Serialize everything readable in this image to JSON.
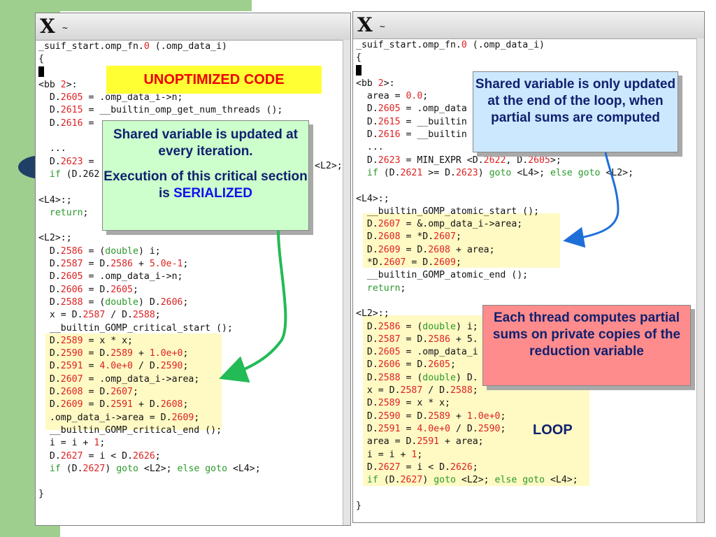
{
  "left_window": {
    "title_icon": "x-window-icon",
    "title": "~",
    "lines": [
      [
        [
          "_suif_start.omp_fn.",
          ""
        ],
        [
          "0",
          "num"
        ],
        [
          " (.omp_data_i)",
          ""
        ]
      ],
      [
        [
          "{",
          ""
        ]
      ],
      [
        [
          "__CURSOR__",
          ""
        ]
      ],
      [
        [
          "<bb ",
          ""
        ],
        [
          "2",
          "num"
        ],
        [
          ">:",
          ""
        ]
      ],
      [
        [
          "  D.",
          ""
        ],
        [
          "2605",
          "num"
        ],
        [
          " = .omp_data_i->n;",
          ""
        ]
      ],
      [
        [
          "  D.",
          ""
        ],
        [
          "2615",
          "num"
        ],
        [
          " = __builtin_omp_get_num_threads ();",
          ""
        ]
      ],
      [
        [
          "  D.",
          ""
        ],
        [
          "2616",
          "num"
        ],
        [
          " = ",
          ""
        ]
      ],
      [
        [
          "",
          ""
        ]
      ],
      [
        [
          "  ...",
          ""
        ]
      ],
      [
        [
          "  D.",
          ""
        ],
        [
          "2623",
          "num"
        ],
        [
          " = ",
          ""
        ]
      ],
      [
        [
          "  ",
          ""
        ],
        [
          "if",
          "kw"
        ],
        [
          " (D.",
          ""
        ],
        [
          "262",
          ""
        ]
      ],
      [
        [
          "",
          ""
        ]
      ],
      [
        [
          "<L4>:;",
          ""
        ]
      ],
      [
        [
          "  ",
          ""
        ],
        [
          "return",
          "kw"
        ],
        [
          ";",
          ""
        ]
      ],
      [
        [
          "",
          ""
        ]
      ],
      [
        [
          "<L2>:;",
          ""
        ]
      ],
      [
        [
          "  D.",
          ""
        ],
        [
          "2586",
          "num"
        ],
        [
          " = (",
          ""
        ],
        [
          "double",
          "ty"
        ],
        [
          ") i;",
          ""
        ]
      ],
      [
        [
          "  D.",
          ""
        ],
        [
          "2587",
          "num"
        ],
        [
          " = D.",
          ""
        ],
        [
          "2586",
          "num"
        ],
        [
          " + ",
          ""
        ],
        [
          "5.0e-1",
          "num"
        ],
        [
          ";",
          ""
        ]
      ],
      [
        [
          "  D.",
          ""
        ],
        [
          "2605",
          "num"
        ],
        [
          " = .omp_data_i->n;",
          ""
        ]
      ],
      [
        [
          "  D.",
          ""
        ],
        [
          "2606",
          "num"
        ],
        [
          " = D.",
          ""
        ],
        [
          "2605",
          "num"
        ],
        [
          ";",
          ""
        ]
      ],
      [
        [
          "  D.",
          ""
        ],
        [
          "2588",
          "num"
        ],
        [
          " = (",
          ""
        ],
        [
          "double",
          "ty"
        ],
        [
          ") D.",
          ""
        ],
        [
          "2606",
          "num"
        ],
        [
          ";",
          ""
        ]
      ],
      [
        [
          "  x = D.",
          ""
        ],
        [
          "2587",
          "num"
        ],
        [
          " / D.",
          ""
        ],
        [
          "2588",
          "num"
        ],
        [
          ";",
          ""
        ]
      ],
      [
        [
          "  __builtin_GOMP_critical_start ();",
          ""
        ]
      ],
      [
        [
          "  D.",
          ""
        ],
        [
          "2589",
          "num"
        ],
        [
          " = x * x;",
          ""
        ]
      ],
      [
        [
          "  D.",
          ""
        ],
        [
          "2590",
          "num"
        ],
        [
          " = D.",
          ""
        ],
        [
          "2589",
          "num"
        ],
        [
          " + ",
          ""
        ],
        [
          "1.0e+0",
          "num"
        ],
        [
          ";",
          ""
        ]
      ],
      [
        [
          "  D.",
          ""
        ],
        [
          "2591",
          "num"
        ],
        [
          " = ",
          ""
        ],
        [
          "4.0e+0",
          "num"
        ],
        [
          " / D.",
          ""
        ],
        [
          "2590",
          "num"
        ],
        [
          ";",
          ""
        ]
      ],
      [
        [
          "  D.",
          ""
        ],
        [
          "2607",
          "num"
        ],
        [
          " = .omp_data_i->area;",
          ""
        ]
      ],
      [
        [
          "  D.",
          ""
        ],
        [
          "2608",
          "num"
        ],
        [
          " = D.",
          ""
        ],
        [
          "2607",
          "num"
        ],
        [
          ";",
          ""
        ]
      ],
      [
        [
          "  D.",
          ""
        ],
        [
          "2609",
          "num"
        ],
        [
          " = D.",
          ""
        ],
        [
          "2591",
          "num"
        ],
        [
          " + D.",
          ""
        ],
        [
          "2608",
          "num"
        ],
        [
          ";",
          ""
        ]
      ],
      [
        [
          "  .omp_data_i->area = D.",
          ""
        ],
        [
          "2609",
          "num"
        ],
        [
          ";",
          ""
        ]
      ],
      [
        [
          "  __builtin_GOMP_critical_end ();",
          ""
        ]
      ],
      [
        [
          "  i = i + ",
          ""
        ],
        [
          "1",
          "num"
        ],
        [
          ";",
          ""
        ]
      ],
      [
        [
          "  D.",
          ""
        ],
        [
          "2627",
          "num"
        ],
        [
          " = i < D.",
          ""
        ],
        [
          "2626",
          "num"
        ],
        [
          ";",
          ""
        ]
      ],
      [
        [
          "  ",
          ""
        ],
        [
          "if",
          "kw"
        ],
        [
          " (D.",
          ""
        ],
        [
          "2627",
          "num"
        ],
        [
          ") ",
          ""
        ],
        [
          "goto",
          "kw"
        ],
        [
          " <L2>; ",
          ""
        ],
        [
          "else goto",
          "kw"
        ],
        [
          " <L4>;",
          ""
        ]
      ],
      [
        [
          "",
          ""
        ]
      ],
      [
        [
          "}",
          ""
        ]
      ]
    ],
    "fragment_l2": "<L2>;"
  },
  "right_window": {
    "title_icon": "x-window-icon",
    "title": "~",
    "lines": [
      [
        [
          "_suif_start.omp_fn.",
          ""
        ],
        [
          "0",
          "num"
        ],
        [
          " (.omp_data_i)",
          ""
        ]
      ],
      [
        [
          "{",
          ""
        ]
      ],
      [
        [
          "__CURSOR__",
          ""
        ]
      ],
      [
        [
          "<bb ",
          ""
        ],
        [
          "2",
          "num"
        ],
        [
          ">:",
          ""
        ]
      ],
      [
        [
          "  area = ",
          ""
        ],
        [
          "0.0",
          "num"
        ],
        [
          ";",
          ""
        ]
      ],
      [
        [
          "  D.",
          ""
        ],
        [
          "2605",
          "num"
        ],
        [
          " = .omp_data",
          ""
        ]
      ],
      [
        [
          "  D.",
          ""
        ],
        [
          "2615",
          "num"
        ],
        [
          " = __builtin",
          ""
        ]
      ],
      [
        [
          "  D.",
          ""
        ],
        [
          "2616",
          "num"
        ],
        [
          " = __builtin",
          ""
        ]
      ],
      [
        [
          "  ...",
          ""
        ]
      ],
      [
        [
          "  D.",
          ""
        ],
        [
          "2623",
          "num"
        ],
        [
          " = MIN_EXPR <D.",
          ""
        ],
        [
          "2622",
          "num"
        ],
        [
          ", D.",
          ""
        ],
        [
          "2605",
          "num"
        ],
        [
          ">;",
          ""
        ]
      ],
      [
        [
          "  ",
          ""
        ],
        [
          "if",
          "kw"
        ],
        [
          " (D.",
          ""
        ],
        [
          "2621",
          "num"
        ],
        [
          " >= D.",
          ""
        ],
        [
          "2623",
          "num"
        ],
        [
          ") ",
          ""
        ],
        [
          "goto",
          "kw"
        ],
        [
          " <L4>; ",
          ""
        ],
        [
          "else goto",
          "kw"
        ],
        [
          " <L2>;",
          ""
        ]
      ],
      [
        [
          "",
          ""
        ]
      ],
      [
        [
          "<L4>:;",
          ""
        ]
      ],
      [
        [
          "  __builtin_GOMP_atomic_start ();",
          ""
        ]
      ],
      [
        [
          "  D.",
          ""
        ],
        [
          "2607",
          "num"
        ],
        [
          " = &.omp_data_i->area;",
          ""
        ]
      ],
      [
        [
          "  D.",
          ""
        ],
        [
          "2608",
          "num"
        ],
        [
          " = *D.",
          ""
        ],
        [
          "2607",
          "num"
        ],
        [
          ";",
          ""
        ]
      ],
      [
        [
          "  D.",
          ""
        ],
        [
          "2609",
          "num"
        ],
        [
          " = D.",
          ""
        ],
        [
          "2608",
          "num"
        ],
        [
          " + area;",
          ""
        ]
      ],
      [
        [
          "  *D.",
          ""
        ],
        [
          "2607",
          "num"
        ],
        [
          " = D.",
          ""
        ],
        [
          "2609",
          "num"
        ],
        [
          ";",
          ""
        ]
      ],
      [
        [
          "  __builtin_GOMP_atomic_end ();",
          ""
        ]
      ],
      [
        [
          "  ",
          ""
        ],
        [
          "return",
          "kw"
        ],
        [
          ";",
          ""
        ]
      ],
      [
        [
          "",
          ""
        ]
      ],
      [
        [
          "<L2>:;",
          ""
        ]
      ],
      [
        [
          "  D.",
          ""
        ],
        [
          "2586",
          "num"
        ],
        [
          " = (",
          ""
        ],
        [
          "double",
          "ty"
        ],
        [
          ") i;",
          ""
        ]
      ],
      [
        [
          "  D.",
          ""
        ],
        [
          "2587",
          "num"
        ],
        [
          " = D.",
          ""
        ],
        [
          "2586",
          "num"
        ],
        [
          " + ",
          ""
        ],
        [
          "5.",
          ""
        ]
      ],
      [
        [
          "  D.",
          ""
        ],
        [
          "2605",
          "num"
        ],
        [
          " = .omp_data_i",
          ""
        ]
      ],
      [
        [
          "  D.",
          ""
        ],
        [
          "2606",
          "num"
        ],
        [
          " = D.",
          ""
        ],
        [
          "2605",
          "num"
        ],
        [
          ";",
          ""
        ]
      ],
      [
        [
          "  D.",
          ""
        ],
        [
          "2588",
          "num"
        ],
        [
          " = (",
          ""
        ],
        [
          "double",
          "ty"
        ],
        [
          ") D.",
          ""
        ]
      ],
      [
        [
          "  x = D.",
          ""
        ],
        [
          "2587",
          "num"
        ],
        [
          " / D.",
          ""
        ],
        [
          "2588",
          "num"
        ],
        [
          ";",
          ""
        ]
      ],
      [
        [
          "  D.",
          ""
        ],
        [
          "2589",
          "num"
        ],
        [
          " = x * x;",
          ""
        ]
      ],
      [
        [
          "  D.",
          ""
        ],
        [
          "2590",
          "num"
        ],
        [
          " = D.",
          ""
        ],
        [
          "2589",
          "num"
        ],
        [
          " + ",
          ""
        ],
        [
          "1.0e+0",
          "num"
        ],
        [
          ";",
          ""
        ]
      ],
      [
        [
          "  D.",
          ""
        ],
        [
          "2591",
          "num"
        ],
        [
          " = ",
          ""
        ],
        [
          "4.0e+0",
          "num"
        ],
        [
          " / D.",
          ""
        ],
        [
          "2590",
          "num"
        ],
        [
          ";",
          ""
        ]
      ],
      [
        [
          "  area = D.",
          ""
        ],
        [
          "2591",
          "num"
        ],
        [
          " + area;",
          ""
        ]
      ],
      [
        [
          "  i = i + ",
          ""
        ],
        [
          "1",
          "num"
        ],
        [
          ";",
          ""
        ]
      ],
      [
        [
          "  D.",
          ""
        ],
        [
          "2627",
          "num"
        ],
        [
          " = i < D.",
          ""
        ],
        [
          "2626",
          "num"
        ],
        [
          ";",
          ""
        ]
      ],
      [
        [
          "  ",
          ""
        ],
        [
          "if",
          "kw"
        ],
        [
          " (D.",
          ""
        ],
        [
          "2627",
          "num"
        ],
        [
          ") ",
          ""
        ],
        [
          "goto",
          "kw"
        ],
        [
          " <L2>; ",
          ""
        ],
        [
          "else goto",
          "kw"
        ],
        [
          " <L4>;",
          ""
        ]
      ],
      [
        [
          "",
          ""
        ]
      ],
      [
        [
          "}",
          ""
        ]
      ]
    ]
  },
  "callouts": {
    "unoptimized": "UNOPTIMIZED CODE",
    "serialized_line1": "Shared variable is updated at every iteration.",
    "serialized_line2_prefix": "Execution of this critical section is ",
    "serialized_line2_emph": "SERIALIZED",
    "shared_end": "Shared variable is only updated at the end of the loop, when partial sums are computed",
    "partial_sums": "Each thread computes partial sums on private copies of the reduction variable",
    "loop": "LOOP"
  },
  "colors": {
    "number": "#dd2222",
    "keyword": "#2a9a2a",
    "highlight": "#fff9c4",
    "green_arrow": "#22bb55",
    "blue_arrow": "#1e6fd9"
  }
}
